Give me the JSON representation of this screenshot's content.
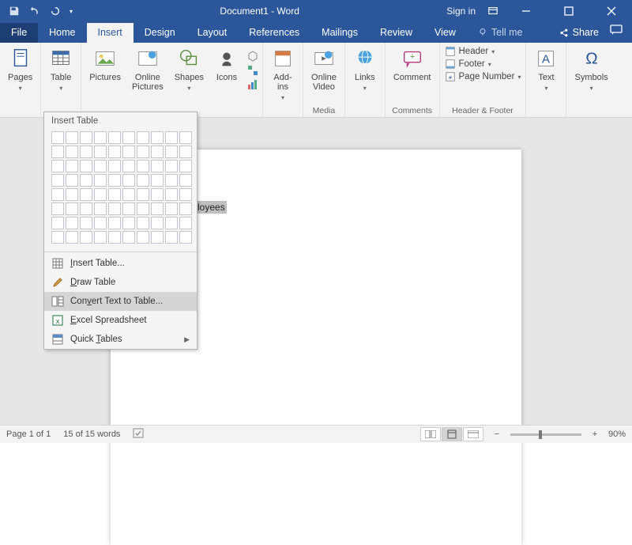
{
  "title": "Document1 - Word",
  "signin": "Sign in",
  "tabs": {
    "file": "File",
    "home": "Home",
    "insert": "Insert",
    "design": "Design",
    "layout": "Layout",
    "references": "References",
    "mailings": "Mailings",
    "review": "Review",
    "view": "View",
    "tellme": "Tell me",
    "share": "Share"
  },
  "ribbon": {
    "pages": "Pages",
    "table": "Table",
    "pictures": "Pictures",
    "online_pictures": "Online\nPictures",
    "shapes": "Shapes",
    "icons": "Icons",
    "addins": "Add-\nins",
    "online_video": "Online\nVideo",
    "links": "Links",
    "comment": "Comment",
    "header": "Header",
    "footer": "Footer",
    "page_number": "Page Number",
    "text": "Text",
    "symbols": "Symbols",
    "grp_media": "Media",
    "grp_comments": "Comments",
    "grp_headerfooter": "Header & Footer"
  },
  "tablemenu": {
    "title": "Insert Table",
    "insert_table": "Insert Table...",
    "draw_table": "Draw Table",
    "convert": "Convert Text to Table...",
    "excel": "Excel Spreadsheet",
    "quick": "Quick Tables"
  },
  "doc": {
    "selected_text": "of Employees"
  },
  "status": {
    "page": "Page 1 of 1",
    "words": "15 of 15 words",
    "zoom": "90%"
  }
}
